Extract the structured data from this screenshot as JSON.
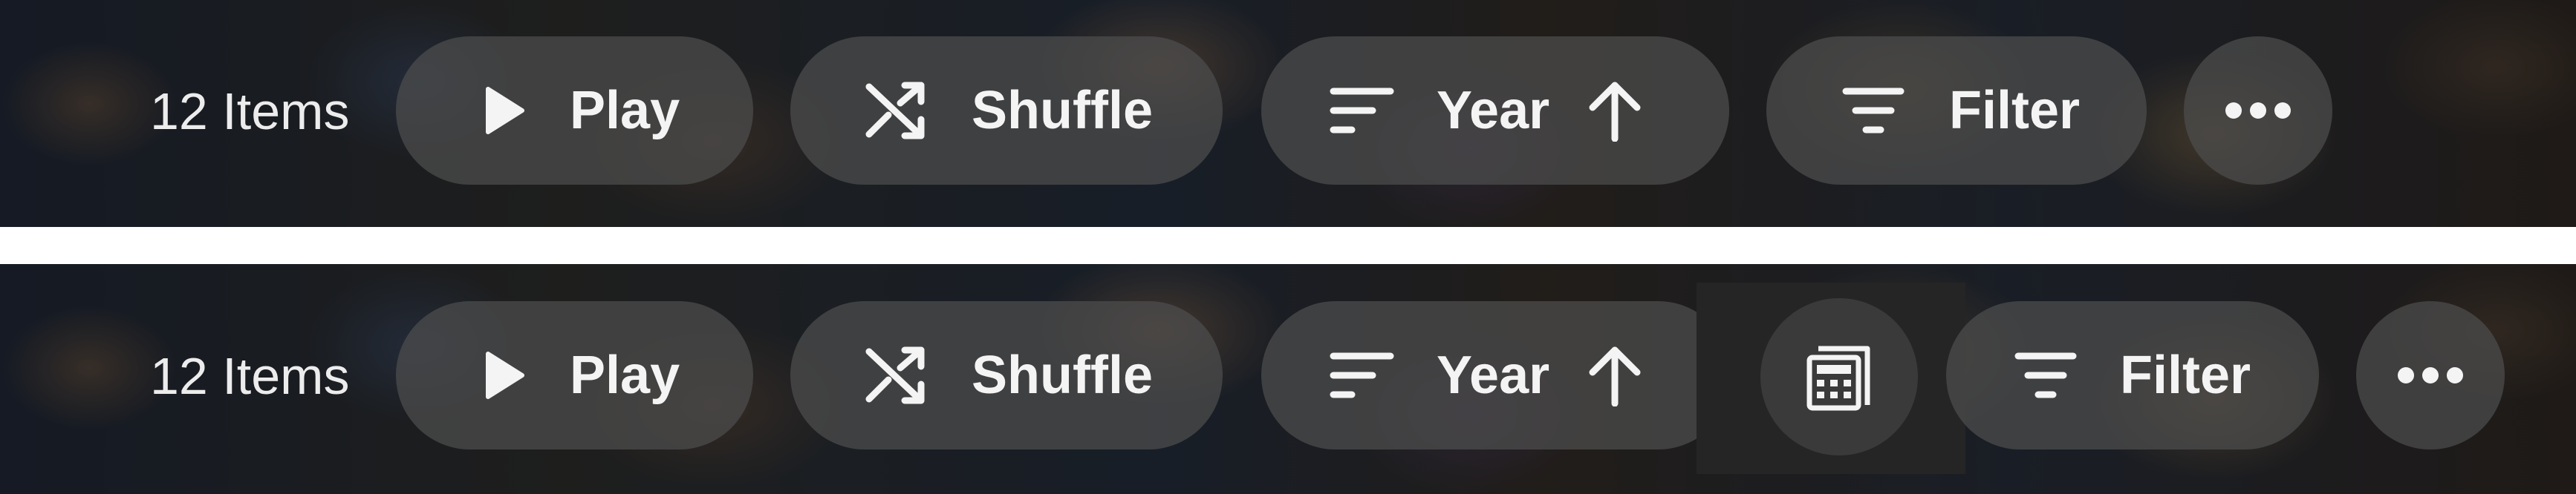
{
  "rows": [
    {
      "item_count": "12 Items",
      "play_label": "Play",
      "shuffle_label": "Shuffle",
      "sort_label": "Year",
      "filter_label": "Filter",
      "more_icon": "more-horizontal-icon"
    },
    {
      "item_count": "12 Items",
      "play_label": "Play",
      "shuffle_label": "Shuffle",
      "sort_label": "Year",
      "filter_label": "Filter",
      "calculator_icon": "calculator-icon",
      "more_icon": "more-horizontal-icon"
    }
  ],
  "colors": {
    "pill_background": "#4e4e4e",
    "text": "#f4f4f4",
    "focus_box": "#252525"
  }
}
